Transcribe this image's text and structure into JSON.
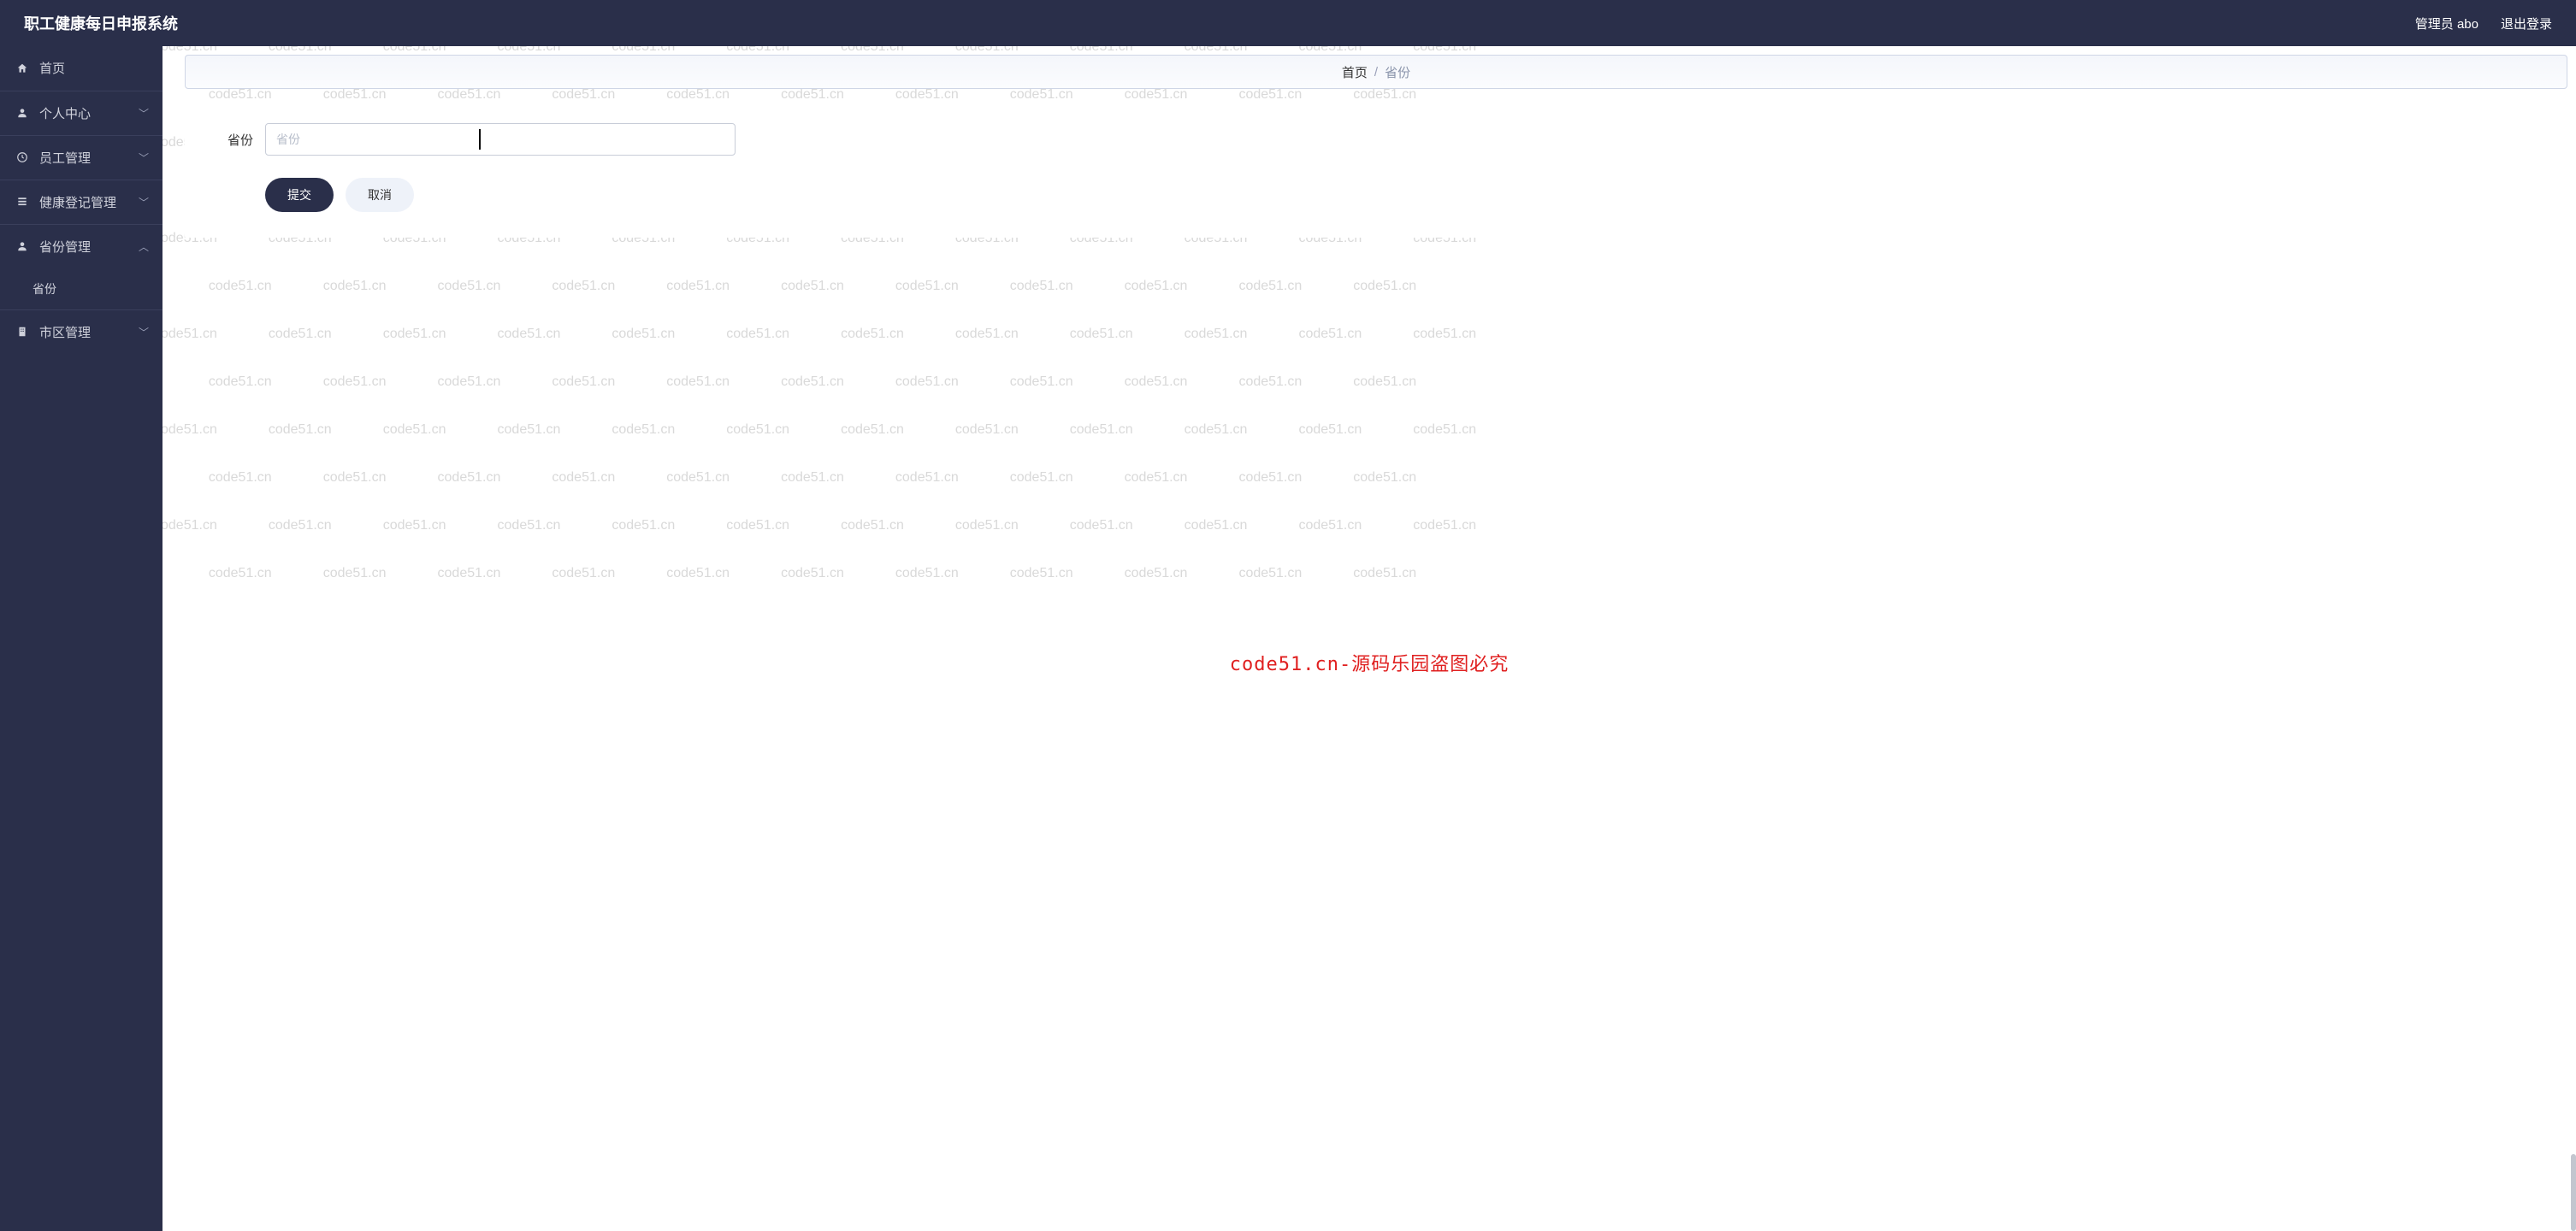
{
  "header": {
    "title": "职工健康每日申报系统",
    "admin_label": "管理员 abo",
    "logout_label": "退出登录"
  },
  "sidebar": {
    "home": "首页",
    "personal": "个人中心",
    "employee": "员工管理",
    "health": "健康登记管理",
    "province": "省份管理",
    "province_child": "省份",
    "city": "市区管理"
  },
  "breadcrumb": {
    "home": "首页",
    "current": "省份"
  },
  "form": {
    "label": "省份",
    "placeholder": "省份",
    "submit": "提交",
    "cancel": "取消"
  },
  "watermark": {
    "token": "code51.cn",
    "red_text": "code51.cn-源码乐园盗图必究"
  }
}
